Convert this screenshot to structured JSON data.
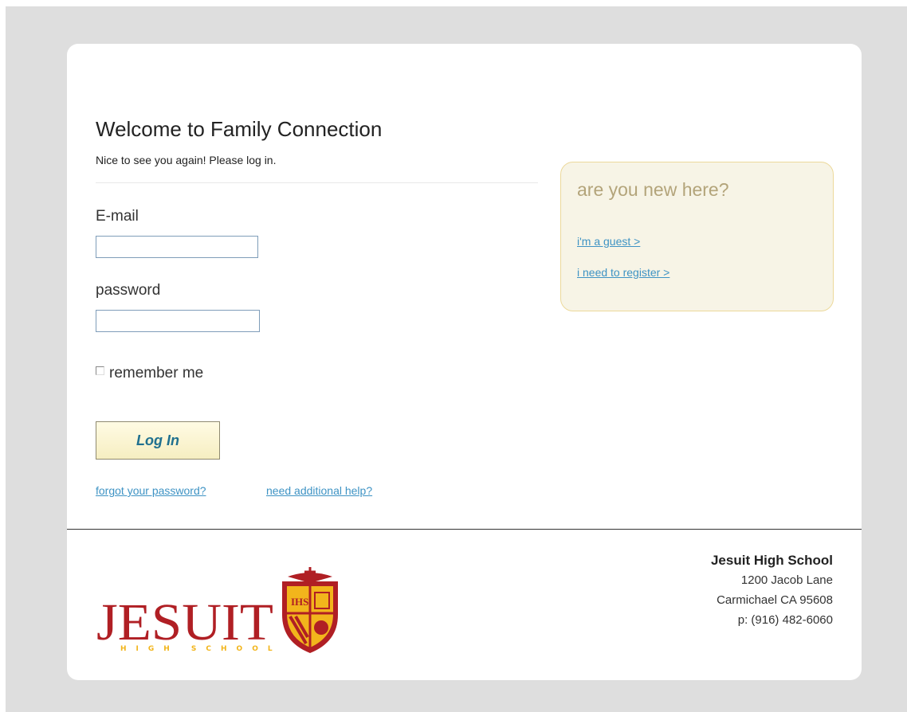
{
  "login": {
    "title": "Welcome to Family Connection",
    "subtitle": "Nice to see you again! Please log in.",
    "email_label": "E-mail",
    "email_value": "",
    "password_label": "password",
    "password_value": "",
    "remember_label": "remember me",
    "remember_checked": false,
    "login_button": "Log In",
    "forgot_link": "forgot your password?",
    "help_link": "need additional help?"
  },
  "new_here": {
    "title": "are you new here?",
    "guest_link": "i'm a guest >",
    "register_link": "i need to register >"
  },
  "logo": {
    "wordmark": "JESUIT",
    "subtext": "HIGH SCHOOL",
    "crest_text": "IHS"
  },
  "school": {
    "name": "Jesuit High School",
    "street": "1200 Jacob Lane",
    "city": "Carmichael CA 95608",
    "phone": "p: (916) 482-6060"
  },
  "colors": {
    "page_background": "#dedede",
    "link": "#3e93c4",
    "button_text": "#20708f",
    "new_box_background": "#f7f4e6",
    "new_box_border": "#ecd99b",
    "new_box_title": "#b3a47a",
    "logo_red": "#b01f24",
    "logo_gold": "#f2b51c"
  }
}
